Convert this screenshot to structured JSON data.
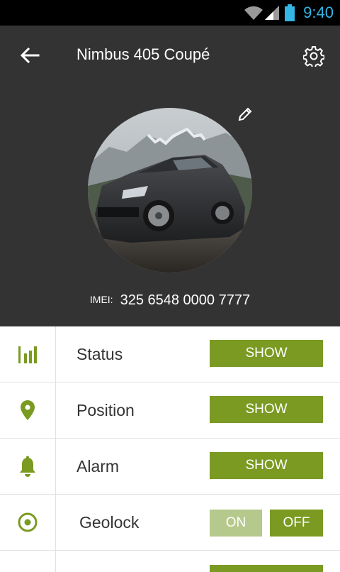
{
  "status_bar": {
    "time": "9:40",
    "accent": "#33b5e5"
  },
  "header": {
    "title": "Nimbus 405 Coupé",
    "imei_label": "IMEI:",
    "imei_value": "325 6548 0000 7777",
    "background": "#333333"
  },
  "icons": {
    "back": "arrow-left-icon",
    "settings": "gear-icon",
    "edit": "pencil-icon",
    "status": "bar-chart-icon",
    "position": "map-pin-icon",
    "alarm": "bell-icon",
    "geolock": "target-icon"
  },
  "rows": [
    {
      "label": "Status",
      "button": "SHOW"
    },
    {
      "label": "Position",
      "button": "SHOW"
    },
    {
      "label": "Alarm",
      "button": "SHOW"
    },
    {
      "label": "Geolock",
      "on_label": "ON",
      "off_label": "OFF",
      "selected": "OFF"
    }
  ],
  "colors": {
    "accent_green": "#7a9a22",
    "inactive_green": "#b6c98c"
  }
}
